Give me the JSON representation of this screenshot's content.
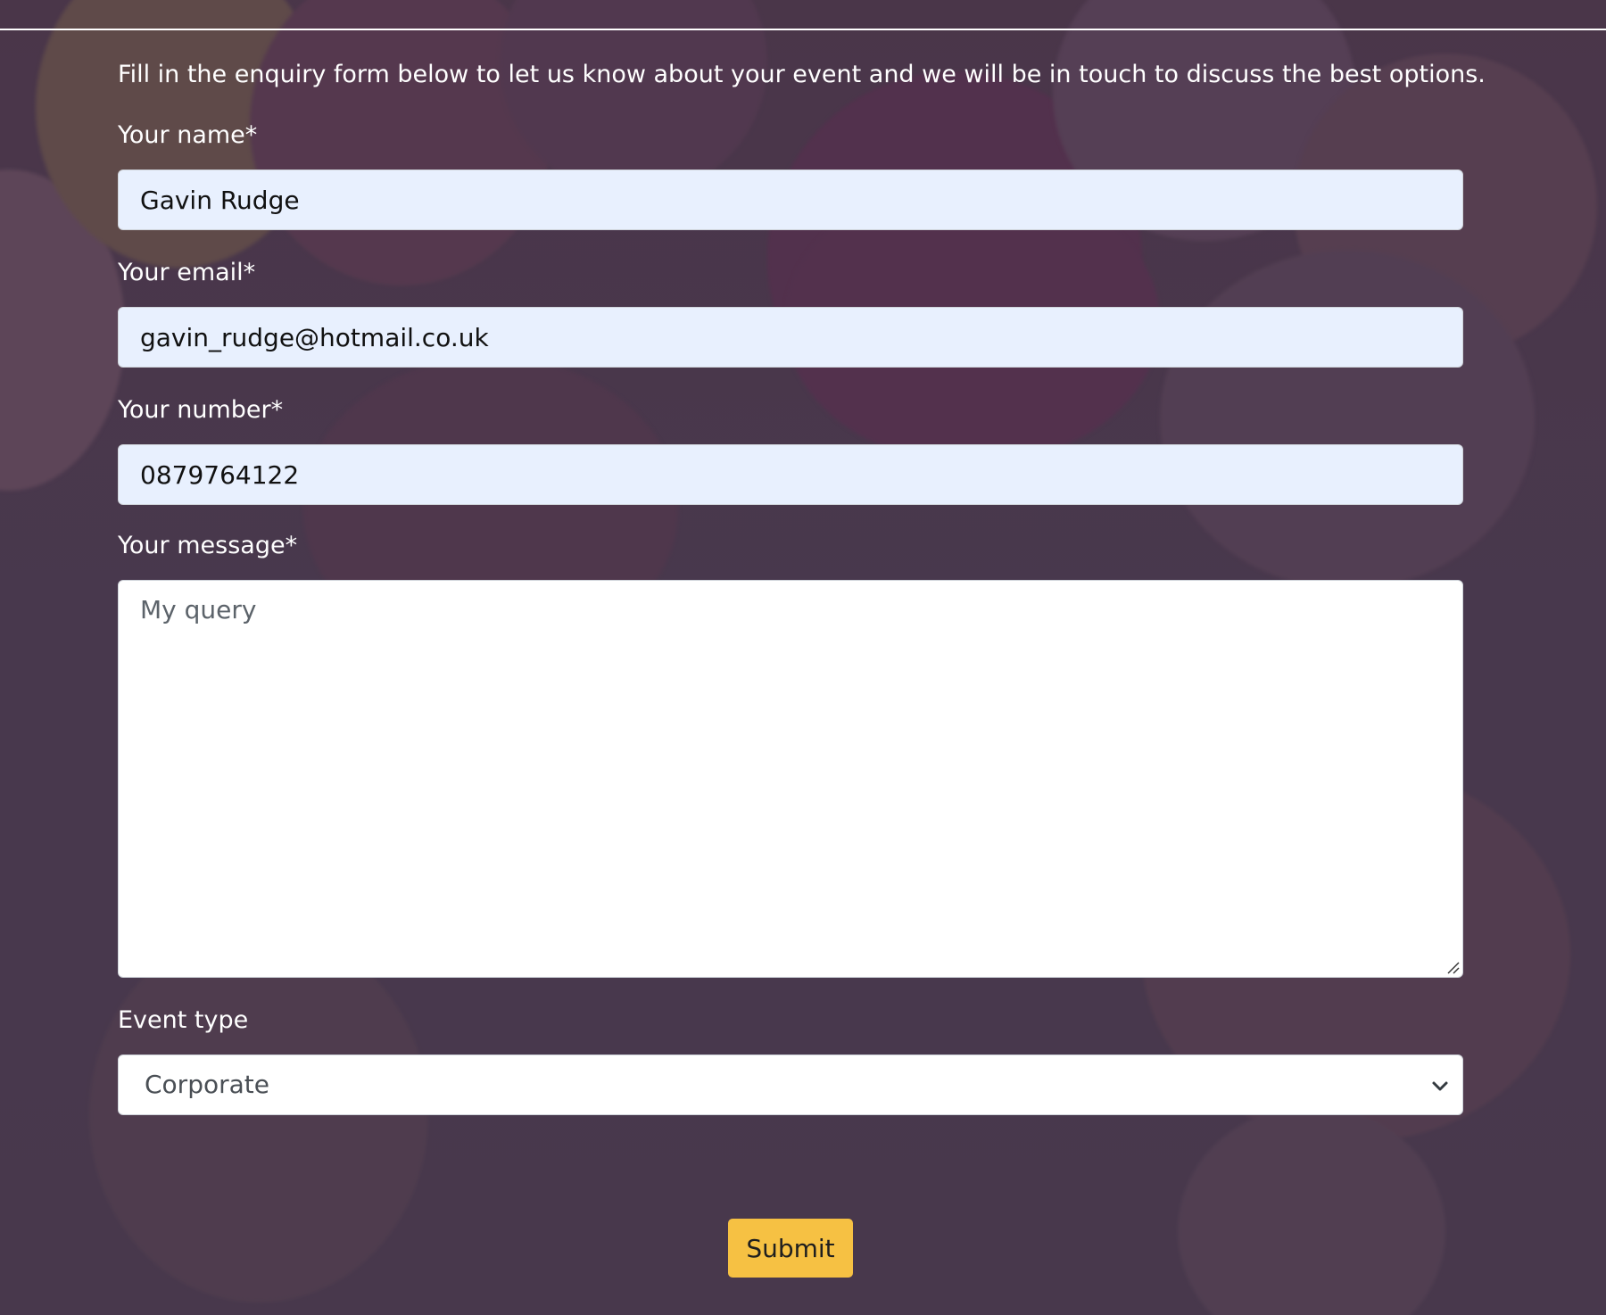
{
  "intro_text": "Fill in the enquiry form below to let us know about your event and we will be in touch to discuss the best options.",
  "fields": {
    "name": {
      "label": "Your name*",
      "value": "Gavin Rudge"
    },
    "email": {
      "label": "Your email*",
      "value": "gavin_rudge@hotmail.co.uk"
    },
    "number": {
      "label": "Your number*",
      "value": "0879764122"
    },
    "message": {
      "label": "Your message*",
      "placeholder": "My query"
    },
    "event_type": {
      "label": "Event type",
      "selected": "Corporate"
    }
  },
  "submit_label": "Submit",
  "colors": {
    "background": "#4a3a4d",
    "autofill_field": "#e8f0fe",
    "submit_button": "#f6c143",
    "text_light": "#ffffff"
  },
  "icons": {
    "select_arrow": "chevron-down-icon",
    "textarea_resize": "resize-grip-icon"
  }
}
